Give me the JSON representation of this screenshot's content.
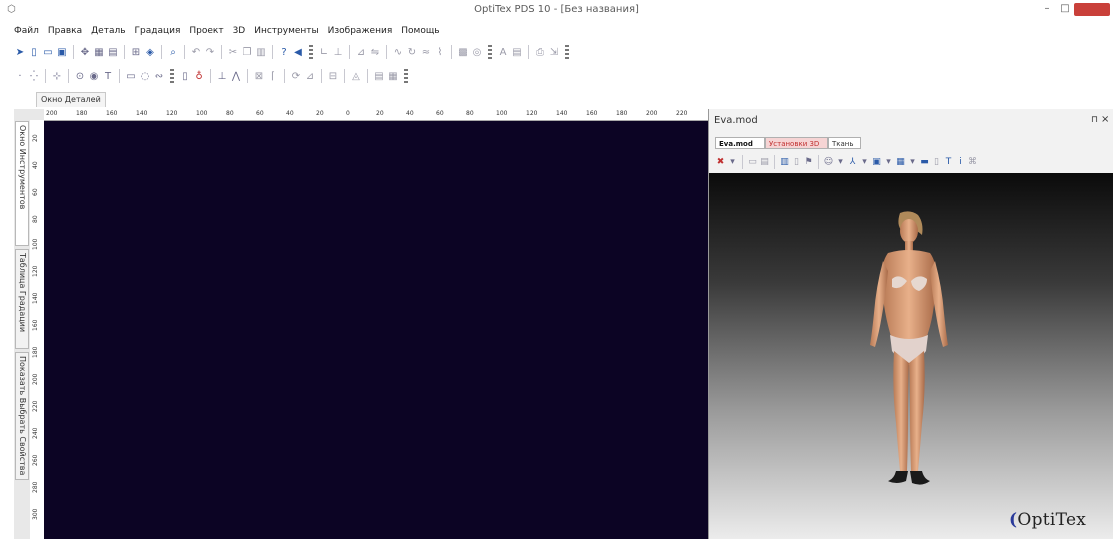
{
  "window": {
    "title": "OptiTex PDS 10 - [Без названия]",
    "min_label": "–",
    "max_label": "□",
    "close_color": "#c9403a"
  },
  "menu": [
    "Файл",
    "Правка",
    "Деталь",
    "Градация",
    "Проект",
    "3D",
    "Инструменты",
    "Изображения",
    "Помощь"
  ],
  "toolbar_icons": {
    "row1": [
      "cursor-icon",
      "new-document-icon",
      "open-folder-icon",
      "save-icon",
      "separator",
      "pan-icon",
      "grid-icon",
      "properties-icon",
      "separator",
      "measure-icon",
      "snap-icon",
      "separator",
      "zoom-icon",
      "separator",
      "undo-icon",
      "redo-icon",
      "separator",
      "cut-icon",
      "copy-icon",
      "paste-icon",
      "separator",
      "help-icon",
      "info-icon",
      "grip",
      "line-icon",
      "notch-icon",
      "separator",
      "grade-icon",
      "mirror-icon",
      "separator",
      "curve-icon",
      "rotate-icon",
      "seam-icon",
      "sewing-icon",
      "separator",
      "group-icon",
      "layout-icon",
      "grip",
      "text-icon",
      "table-icon",
      "separator",
      "plot-icon",
      "export-icon",
      "grip"
    ],
    "row2": [
      "point-icon",
      "marker-icon",
      "separator",
      "grade-point-icon",
      "separator",
      "drill-icon",
      "button-icon",
      "text-tool-icon",
      "separator",
      "rectangle-icon",
      "lasso-icon",
      "curve-tool-icon",
      "grip",
      "delete-icon",
      "pin-icon",
      "separator",
      "notch-tool-icon",
      "dart-icon",
      "separator",
      "fold-icon",
      "pleat-icon",
      "separator",
      "walk-icon",
      "rotate-tool-icon",
      "separator",
      "measure-tool-icon",
      "separator",
      "pieces-icon",
      "separator",
      "sheet-icon",
      "grid-tool-icon",
      "grip"
    ]
  },
  "sheet_tab": "Окно Деталей",
  "ruler": {
    "top_ticks": [
      "200",
      "180",
      "160",
      "140",
      "120",
      "100",
      "80",
      "60",
      "40",
      "20",
      "0",
      "20",
      "40",
      "60",
      "80",
      "100",
      "120",
      "140",
      "160",
      "180",
      "200",
      "220"
    ],
    "left_ticks": [
      "20",
      "40",
      "60",
      "80",
      "100",
      "120",
      "140",
      "160",
      "180",
      "200",
      "220",
      "240",
      "260",
      "280",
      "300"
    ]
  },
  "side_tabs": [
    "Окно Инструментов",
    "Таблица Градации",
    "Показать Выбрать Свойства"
  ],
  "canvas": {
    "background": "#0c0424"
  },
  "panel": {
    "title": "Eva.mod",
    "pin_label": "⊓",
    "close_label": "×",
    "tabs": [
      "Eva.mod",
      "Установки 3D",
      "Ткань"
    ],
    "tab_colors": {
      "active": "#ffffff",
      "settings": "#f6d4d4",
      "settings_text": "#c03030"
    },
    "tools": [
      "close-3d-icon",
      "dropdown-icon",
      "separator",
      "frame-icon",
      "view-icon",
      "separator",
      "sim-icon",
      "drape-icon",
      "clothes-icon",
      "separator",
      "avatar-icon",
      "dropdown-icon",
      "axis-icon",
      "dropdown-icon",
      "camera-icon",
      "dropdown-icon",
      "render-icon",
      "dropdown-icon",
      "folder-icon",
      "copy-3d-icon",
      "text-3d-icon",
      "info-3d-icon",
      "brush-icon"
    ]
  },
  "brand": "OptiTex"
}
